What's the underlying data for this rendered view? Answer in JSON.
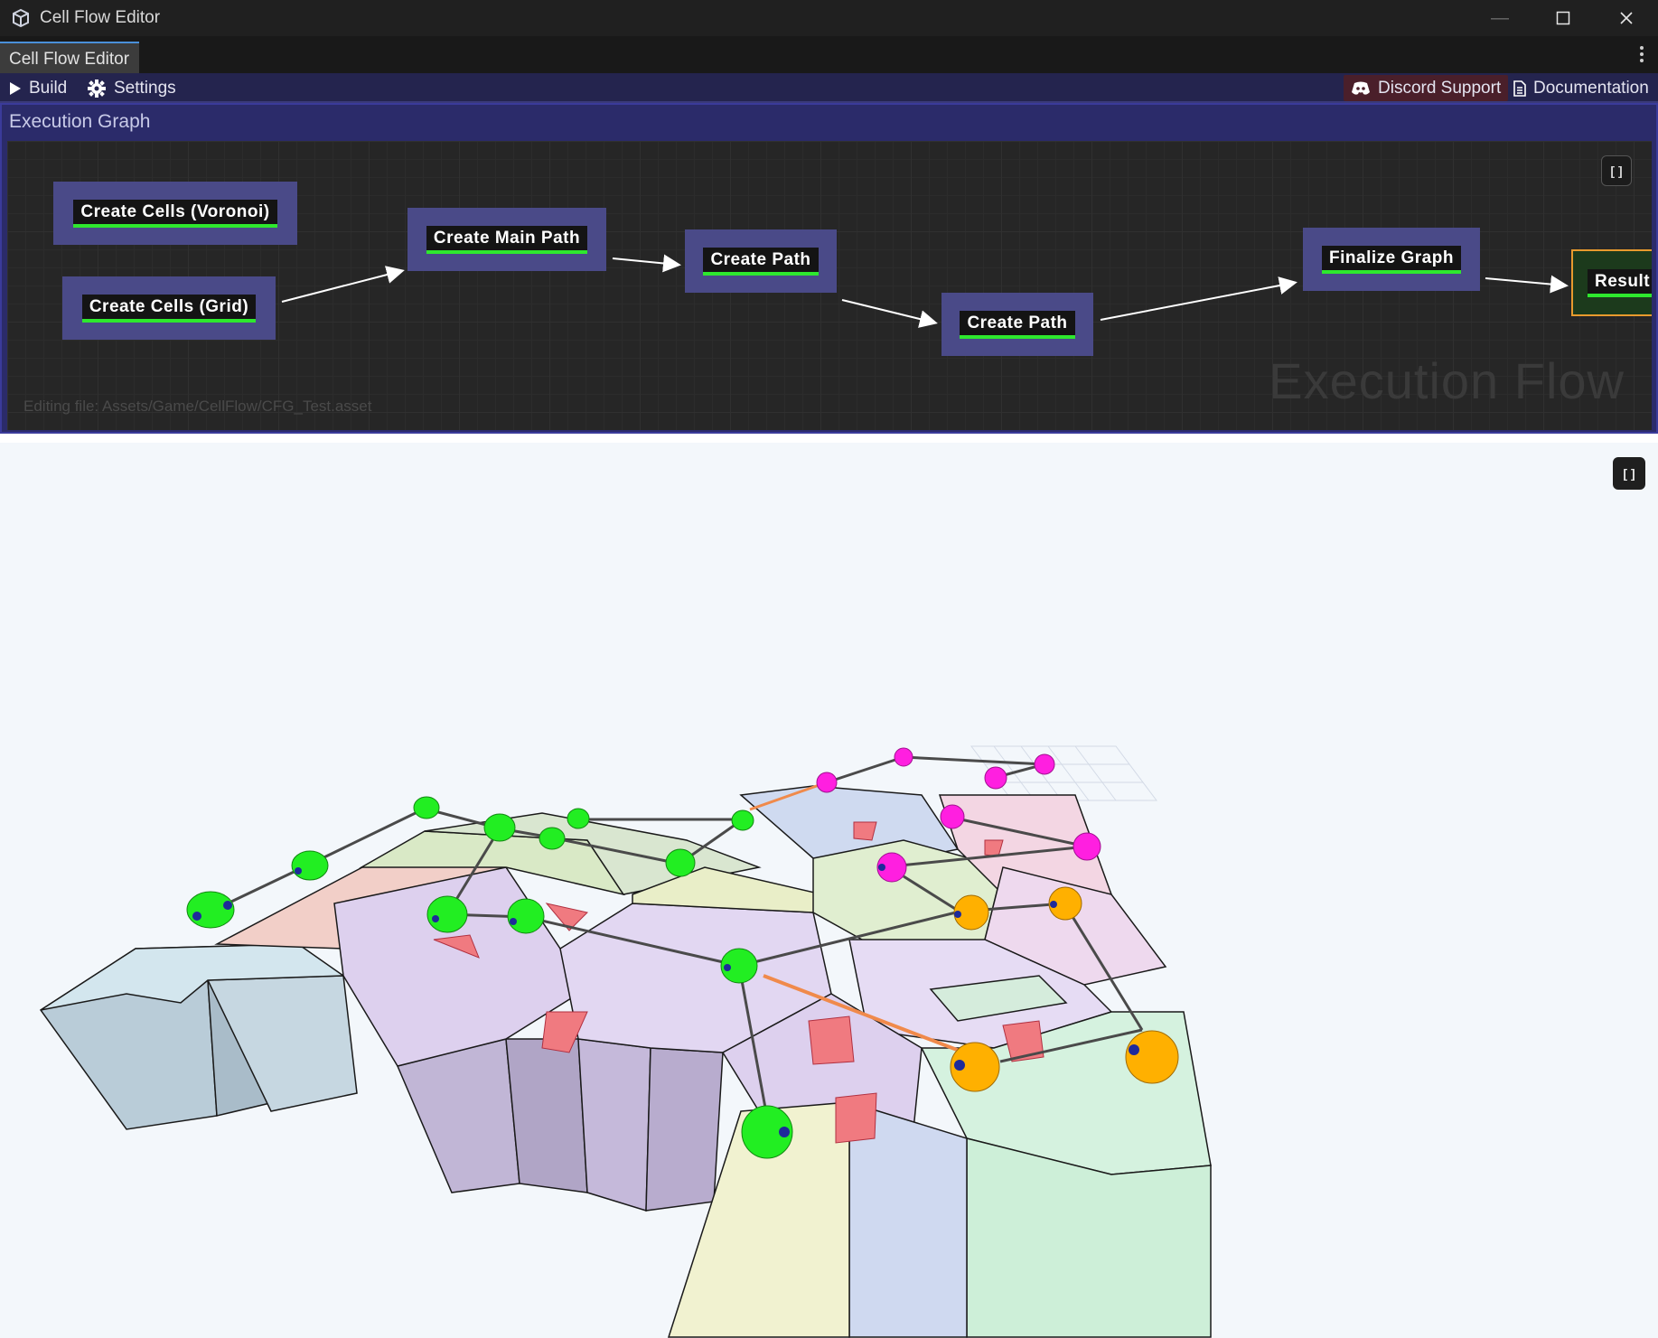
{
  "window": {
    "title": "Cell Flow Editor",
    "controls": {
      "minimize": "—",
      "maximize": "☐",
      "close": "✕"
    }
  },
  "tab": {
    "label": "Cell Flow Editor",
    "menu_icon": "kebab-menu-icon"
  },
  "toolbar": {
    "build_label": "Build",
    "settings_label": "Settings",
    "discord_label": "Discord Support",
    "docs_label": "Documentation"
  },
  "execution_graph": {
    "header": "Execution Graph",
    "watermark": "Execution Flow",
    "editing_file": "Editing file: Assets/Game/CellFlow/CFG_Test.asset",
    "fit_icon": "[ ]",
    "nodes": [
      {
        "id": "voronoi",
        "label": "Create Cells (Voronoi)"
      },
      {
        "id": "grid",
        "label": "Create Cells (Grid)"
      },
      {
        "id": "main-path",
        "label": "Create Main Path"
      },
      {
        "id": "path1",
        "label": "Create Path"
      },
      {
        "id": "path2",
        "label": "Create Path"
      },
      {
        "id": "finalize",
        "label": "Finalize Graph"
      },
      {
        "id": "result",
        "label": "Result"
      }
    ]
  },
  "viewport": {
    "fit_icon": "[ ]",
    "colors": {
      "main_path": "#22ee22",
      "path_a": "#ff1fe0",
      "path_b": "#ffb000",
      "connector": "#555555",
      "special_link": "#f08a4b"
    }
  }
}
